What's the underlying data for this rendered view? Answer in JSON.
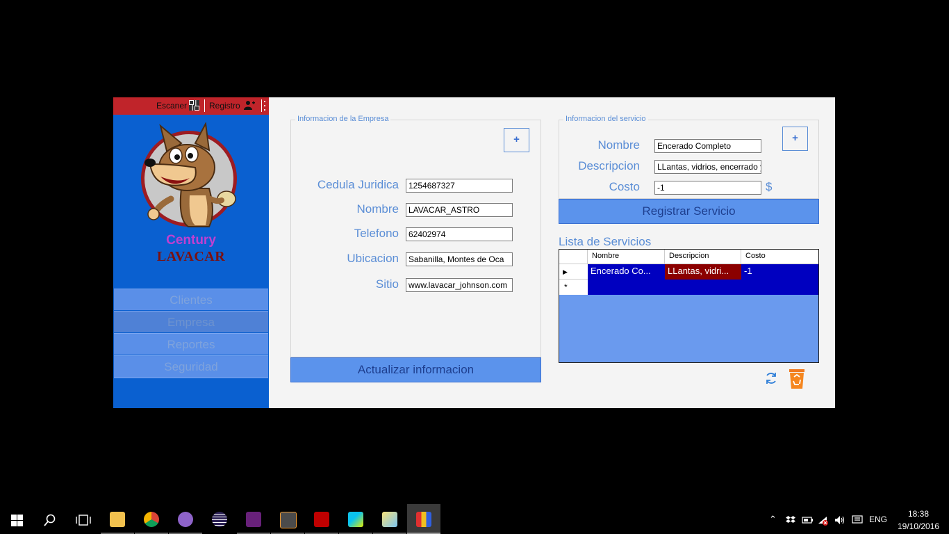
{
  "sidebar": {
    "topbar": {
      "scanner_label": "Escaner",
      "register_label": "Registro"
    },
    "brand_line1": "Century",
    "brand_line2": "LAVACAR",
    "nav": [
      {
        "label": "Clientes"
      },
      {
        "label": "Empresa"
      },
      {
        "label": "Reportes"
      },
      {
        "label": "Seguridad"
      }
    ],
    "active_nav": "Empresa"
  },
  "company": {
    "group_title": "Informacion de la Empresa",
    "add_label": "+",
    "fields": {
      "cedula": {
        "label": "Cedula Juridica",
        "value": "1254687327"
      },
      "nombre": {
        "label": "Nombre",
        "value": "LAVACAR_ASTRO"
      },
      "telefono": {
        "label": "Telefono",
        "value": "62402974"
      },
      "ubicacion": {
        "label": "Ubicacion",
        "value": "Sabanilla, Montes de Oca"
      },
      "sitio": {
        "label": "Sitio",
        "value": "www.lavacar_johnson.com"
      }
    },
    "update_label": "Actualizar informacion"
  },
  "service": {
    "group_title": "Informacion del servicio",
    "add_label": "+",
    "fields": {
      "nombre": {
        "label": "Nombre",
        "value": "Encerado Completo"
      },
      "descripcion": {
        "label": "Descripcion",
        "value": "LLantas, vidrios, encerrado y as"
      },
      "costo": {
        "label": "Costo",
        "value": "-1",
        "currency": "$"
      }
    },
    "register_label": "Registrar Servicio"
  },
  "services_list": {
    "title": "Lista de Servicios",
    "columns": [
      "Nombre",
      "Descripcion",
      "Costo"
    ],
    "rows": [
      {
        "nombre": "Encerado Co...",
        "descripcion": "LLantas, vidri...",
        "costo": "-1"
      }
    ],
    "new_row_marker": "*"
  },
  "taskbar": {
    "language": "ENG",
    "time": "18:38",
    "date": "19/10/2016"
  },
  "colors": {
    "sidebar_blue": "#0a60d0",
    "topbar_red": "#c0242a",
    "accent_label": "#5b8ed6",
    "button_blue": "#5b93ec",
    "grid_selected": "#0000c0",
    "grid_desc_cell": "#8b0000"
  }
}
